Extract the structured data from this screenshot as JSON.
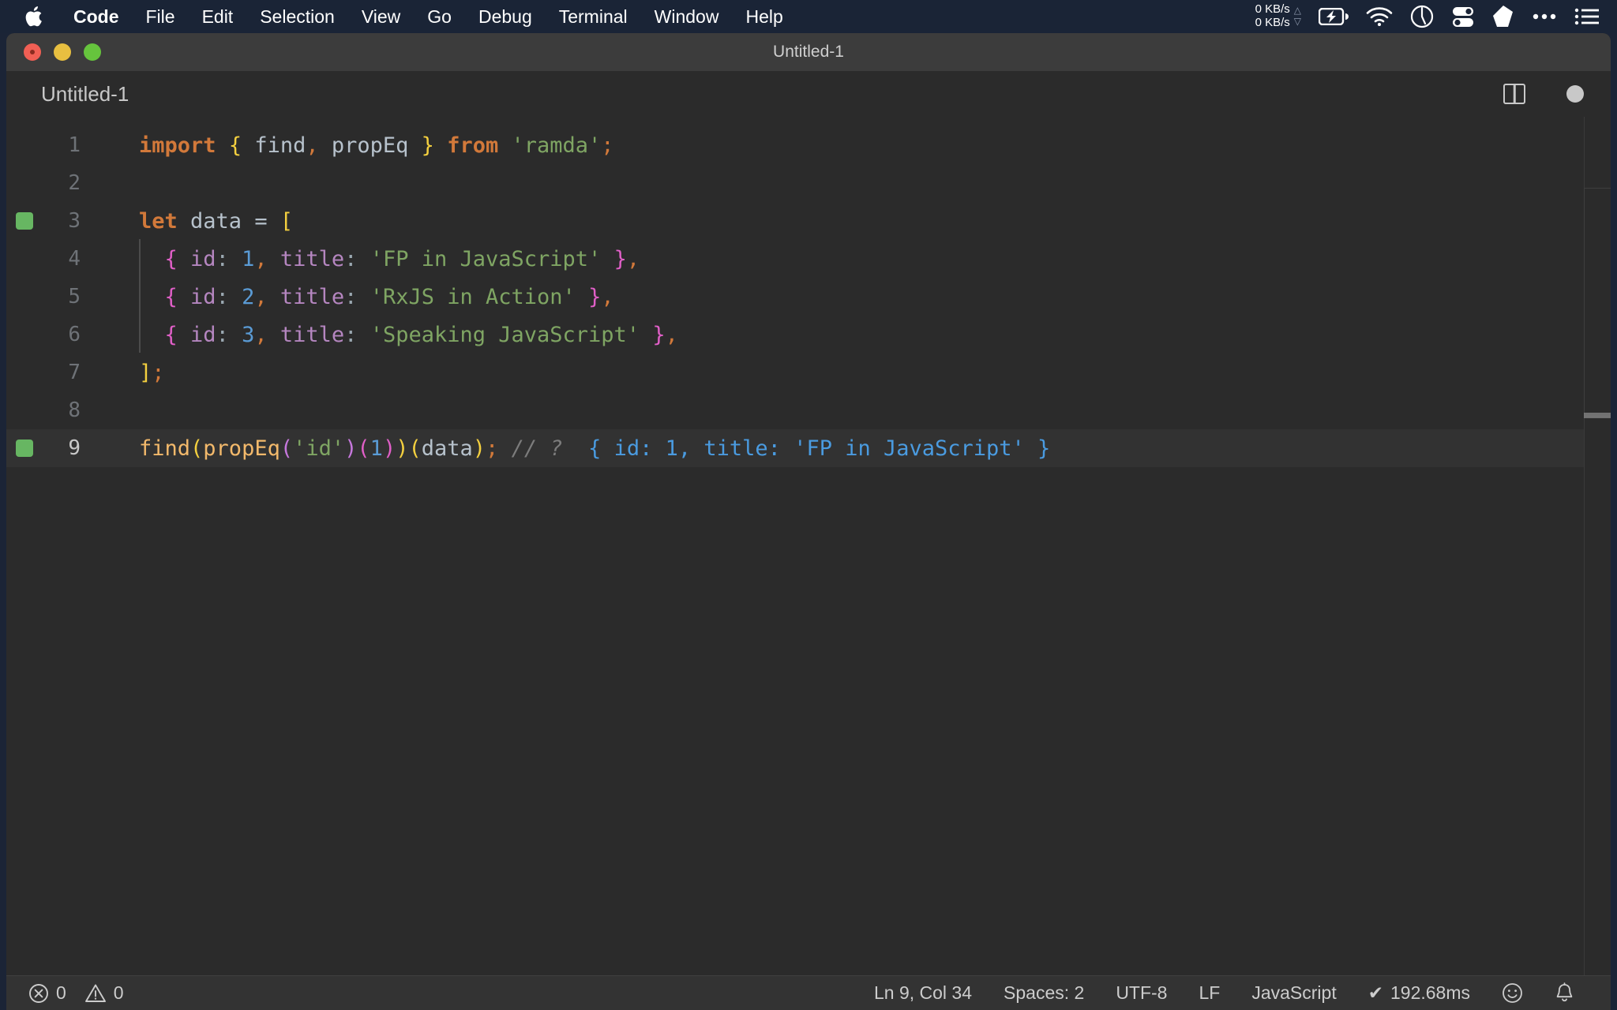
{
  "menubar": {
    "apple_icon": "apple-logo-icon",
    "items": [
      {
        "label": "Code",
        "bold": true
      },
      {
        "label": "File",
        "bold": false
      },
      {
        "label": "Edit",
        "bold": false
      },
      {
        "label": "Selection",
        "bold": false
      },
      {
        "label": "View",
        "bold": false
      },
      {
        "label": "Go",
        "bold": false
      },
      {
        "label": "Debug",
        "bold": false
      },
      {
        "label": "Terminal",
        "bold": false
      },
      {
        "label": "Window",
        "bold": false
      },
      {
        "label": "Help",
        "bold": false
      }
    ],
    "tray": {
      "net_up": "0 KB/s",
      "net_down": "0 KB/s",
      "up_arrow": "△",
      "down_arrow": "▽",
      "icons": [
        "battery-charging-icon",
        "wifi-icon",
        "clock-icon",
        "toggles-icon",
        "shape-icon",
        "ellipsis-icon",
        "menu-list-icon"
      ]
    }
  },
  "window": {
    "title": "Untitled-1",
    "traffic_lights": [
      "close-button",
      "minimize-button",
      "maximize-button"
    ]
  },
  "editor_titlebar": {
    "tab_label": "Untitled-1",
    "split_icon": "split-editor-icon",
    "dirty_indicator": "unsaved-changes-dot"
  },
  "editor": {
    "lines": [
      {
        "number": "1",
        "active": false,
        "marker": false,
        "indent_guide": false,
        "tokens": [
          {
            "t": "import",
            "c": "t-kw"
          },
          {
            "t": " ",
            "c": "t-plain"
          },
          {
            "t": "{",
            "c": "t-brace-y"
          },
          {
            "t": " find",
            "c": "t-plain"
          },
          {
            "t": ",",
            "c": "t-comma"
          },
          {
            "t": " propEq ",
            "c": "t-plain"
          },
          {
            "t": "}",
            "c": "t-brace-y"
          },
          {
            "t": " ",
            "c": "t-plain"
          },
          {
            "t": "from",
            "c": "t-from"
          },
          {
            "t": " ",
            "c": "t-plain"
          },
          {
            "t": "'ramda'",
            "c": "t-str"
          },
          {
            "t": ";",
            "c": "t-semi"
          }
        ]
      },
      {
        "number": "2",
        "active": false,
        "marker": false,
        "indent_guide": false,
        "tokens": []
      },
      {
        "number": "3",
        "active": false,
        "marker": true,
        "indent_guide": false,
        "tokens": [
          {
            "t": "let",
            "c": "t-kw"
          },
          {
            "t": " data ",
            "c": "t-plain"
          },
          {
            "t": "=",
            "c": "t-plain"
          },
          {
            "t": " ",
            "c": "t-plain"
          },
          {
            "t": "[",
            "c": "t-brace-y"
          }
        ]
      },
      {
        "number": "4",
        "active": false,
        "marker": false,
        "indent_guide": true,
        "tokens": [
          {
            "t": "  ",
            "c": "t-plain"
          },
          {
            "t": "{",
            "c": "t-brace-p"
          },
          {
            "t": " ",
            "c": "t-plain"
          },
          {
            "t": "id",
            "c": "t-prop"
          },
          {
            "t": ":",
            "c": "t-colon"
          },
          {
            "t": " ",
            "c": "t-plain"
          },
          {
            "t": "1",
            "c": "t-num"
          },
          {
            "t": ",",
            "c": "t-comma"
          },
          {
            "t": " ",
            "c": "t-plain"
          },
          {
            "t": "title",
            "c": "t-prop"
          },
          {
            "t": ":",
            "c": "t-colon"
          },
          {
            "t": " ",
            "c": "t-plain"
          },
          {
            "t": "'FP in JavaScript'",
            "c": "t-str"
          },
          {
            "t": " ",
            "c": "t-plain"
          },
          {
            "t": "}",
            "c": "t-brace-p"
          },
          {
            "t": ",",
            "c": "t-comma"
          }
        ]
      },
      {
        "number": "5",
        "active": false,
        "marker": false,
        "indent_guide": true,
        "tokens": [
          {
            "t": "  ",
            "c": "t-plain"
          },
          {
            "t": "{",
            "c": "t-brace-p"
          },
          {
            "t": " ",
            "c": "t-plain"
          },
          {
            "t": "id",
            "c": "t-prop"
          },
          {
            "t": ":",
            "c": "t-colon"
          },
          {
            "t": " ",
            "c": "t-plain"
          },
          {
            "t": "2",
            "c": "t-num"
          },
          {
            "t": ",",
            "c": "t-comma"
          },
          {
            "t": " ",
            "c": "t-plain"
          },
          {
            "t": "title",
            "c": "t-prop"
          },
          {
            "t": ":",
            "c": "t-colon"
          },
          {
            "t": " ",
            "c": "t-plain"
          },
          {
            "t": "'RxJS in Action'",
            "c": "t-str"
          },
          {
            "t": " ",
            "c": "t-plain"
          },
          {
            "t": "}",
            "c": "t-brace-p"
          },
          {
            "t": ",",
            "c": "t-comma"
          }
        ]
      },
      {
        "number": "6",
        "active": false,
        "marker": false,
        "indent_guide": true,
        "tokens": [
          {
            "t": "  ",
            "c": "t-plain"
          },
          {
            "t": "{",
            "c": "t-brace-p"
          },
          {
            "t": " ",
            "c": "t-plain"
          },
          {
            "t": "id",
            "c": "t-prop"
          },
          {
            "t": ":",
            "c": "t-colon"
          },
          {
            "t": " ",
            "c": "t-plain"
          },
          {
            "t": "3",
            "c": "t-num"
          },
          {
            "t": ",",
            "c": "t-comma"
          },
          {
            "t": " ",
            "c": "t-plain"
          },
          {
            "t": "title",
            "c": "t-prop"
          },
          {
            "t": ":",
            "c": "t-colon"
          },
          {
            "t": " ",
            "c": "t-plain"
          },
          {
            "t": "'Speaking JavaScript'",
            "c": "t-str"
          },
          {
            "t": " ",
            "c": "t-plain"
          },
          {
            "t": "}",
            "c": "t-brace-p"
          },
          {
            "t": ",",
            "c": "t-comma"
          }
        ]
      },
      {
        "number": "7",
        "active": false,
        "marker": false,
        "indent_guide": false,
        "tokens": [
          {
            "t": "]",
            "c": "t-brace-y"
          },
          {
            "t": ";",
            "c": "t-semi"
          }
        ]
      },
      {
        "number": "8",
        "active": false,
        "marker": false,
        "indent_guide": false,
        "tokens": []
      },
      {
        "number": "9",
        "active": true,
        "marker": true,
        "indent_guide": false,
        "tokens": [
          {
            "t": "find",
            "c": "t-fn"
          },
          {
            "t": "(",
            "c": "t-brace-y"
          },
          {
            "t": "propEq",
            "c": "t-fn"
          },
          {
            "t": "(",
            "c": "t-brace-v"
          },
          {
            "t": "'id'",
            "c": "t-str"
          },
          {
            "t": ")",
            "c": "t-brace-v"
          },
          {
            "t": "(",
            "c": "t-brace-p"
          },
          {
            "t": "1",
            "c": "t-num"
          },
          {
            "t": ")",
            "c": "t-brace-p"
          },
          {
            "t": ")",
            "c": "t-brace-y"
          },
          {
            "t": "(",
            "c": "t-brace-y"
          },
          {
            "t": "data",
            "c": "t-var"
          },
          {
            "t": ")",
            "c": "t-brace-y"
          },
          {
            "t": ";",
            "c": "t-semi"
          },
          {
            "t": " ",
            "c": "t-plain"
          },
          {
            "t": "// ?",
            "c": "t-comment"
          },
          {
            "t": "  { id: 1, title: 'FP in JavaScript' }",
            "c": "t-result"
          }
        ]
      }
    ]
  },
  "statusbar": {
    "errors_icon": "error-circle-icon",
    "errors_count": "0",
    "warnings_icon": "warning-triangle-icon",
    "warnings_count": "0",
    "cursor_position": "Ln 9, Col 34",
    "indentation": "Spaces: 2",
    "encoding": "UTF-8",
    "eol": "LF",
    "language": "JavaScript",
    "quokka_check": "✔",
    "quokka_time": "192.68ms",
    "feedback_icon": "smiley-icon",
    "notifications_icon": "bell-icon"
  },
  "colors": {
    "menubar_bg": "#1a2436",
    "window_titlebar_bg": "#3c3c3c",
    "editor_bg": "#2b2b2b",
    "statusbar_bg": "#333333",
    "active_line_bg": "#323232",
    "quokka_marker": "#67b662",
    "result_blue": "#4a9be0"
  }
}
